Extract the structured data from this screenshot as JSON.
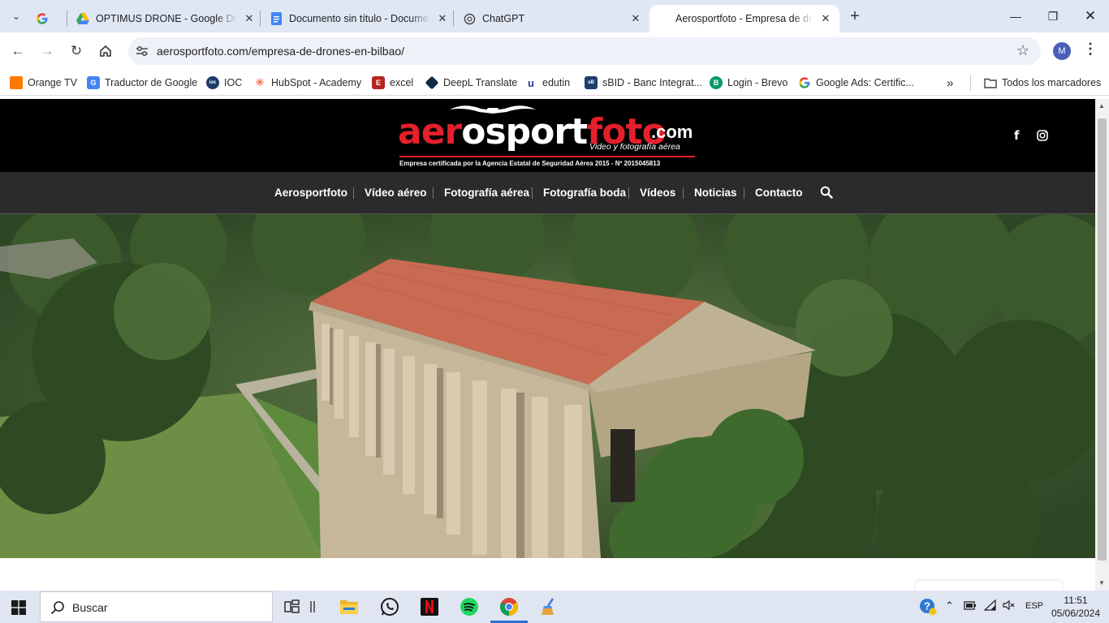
{
  "browser": {
    "tabs": [
      {
        "title": "",
        "favicon": "google-icon"
      },
      {
        "title": "OPTIMUS DRONE - Google Drive",
        "favicon": "google-drive-icon"
      },
      {
        "title": "Documento sin título - Documentos",
        "favicon": "google-docs-icon"
      },
      {
        "title": "ChatGPT",
        "favicon": "chatgpt-icon"
      },
      {
        "title": "Aerosportfoto - Empresa de drones",
        "favicon": "none",
        "active": true
      }
    ],
    "url": "aerosportfoto.com/empresa-de-drones-en-bilbao/",
    "profile_initial": "M"
  },
  "bookmarks": [
    {
      "label": "Orange TV",
      "icon": "orange-tv-icon",
      "color": "#ff7900"
    },
    {
      "label": "Traductor de Google",
      "icon": "google-translate-icon",
      "color": "#4285f4"
    },
    {
      "label": "IOC",
      "icon": "ioc-icon",
      "color": "#1e3a6b"
    },
    {
      "label": "HubSpot - Academy",
      "icon": "hubspot-icon",
      "color": "#ff7a59"
    },
    {
      "label": "excel",
      "icon": "excel-icon",
      "color": "#b3261e"
    },
    {
      "label": "DeepL Translate",
      "icon": "deepl-icon",
      "color": "#0f2b46"
    },
    {
      "label": "edutin",
      "icon": "edutin-icon",
      "color": "#1e3fa0"
    },
    {
      "label": "sBID - Banc Integrat...",
      "icon": "sbid-icon",
      "color": "#1d3f6e"
    },
    {
      "label": "Login - Brevo",
      "icon": "brevo-icon",
      "color": "#0b996e"
    },
    {
      "label": "Google Ads: Certific...",
      "icon": "google-icon",
      "color": "#4285f4"
    }
  ],
  "all_bookmarks_label": "Todos los marcadores",
  "site": {
    "logo_parts": {
      "a": "aer",
      "b": "o",
      "c": "sport",
      "d": "foto",
      "dotcom": ".com"
    },
    "tagline": "Video y fotografía aérea",
    "certification": "Empresa certificada por la Agencia Estatal de Seguridad Aérea 2015 - Nº 2015045813",
    "nav": [
      "Aerosportfoto",
      "Vídeo aéreo",
      "Fotografía aérea",
      "Fotografía boda",
      "Vídeos",
      "Noticias",
      "Contacto"
    ],
    "brand_color": "#e5202b"
  },
  "taskbar": {
    "search_placeholder": "Buscar",
    "language": "ESP",
    "time": "11:51",
    "date": "05/06/2024"
  }
}
